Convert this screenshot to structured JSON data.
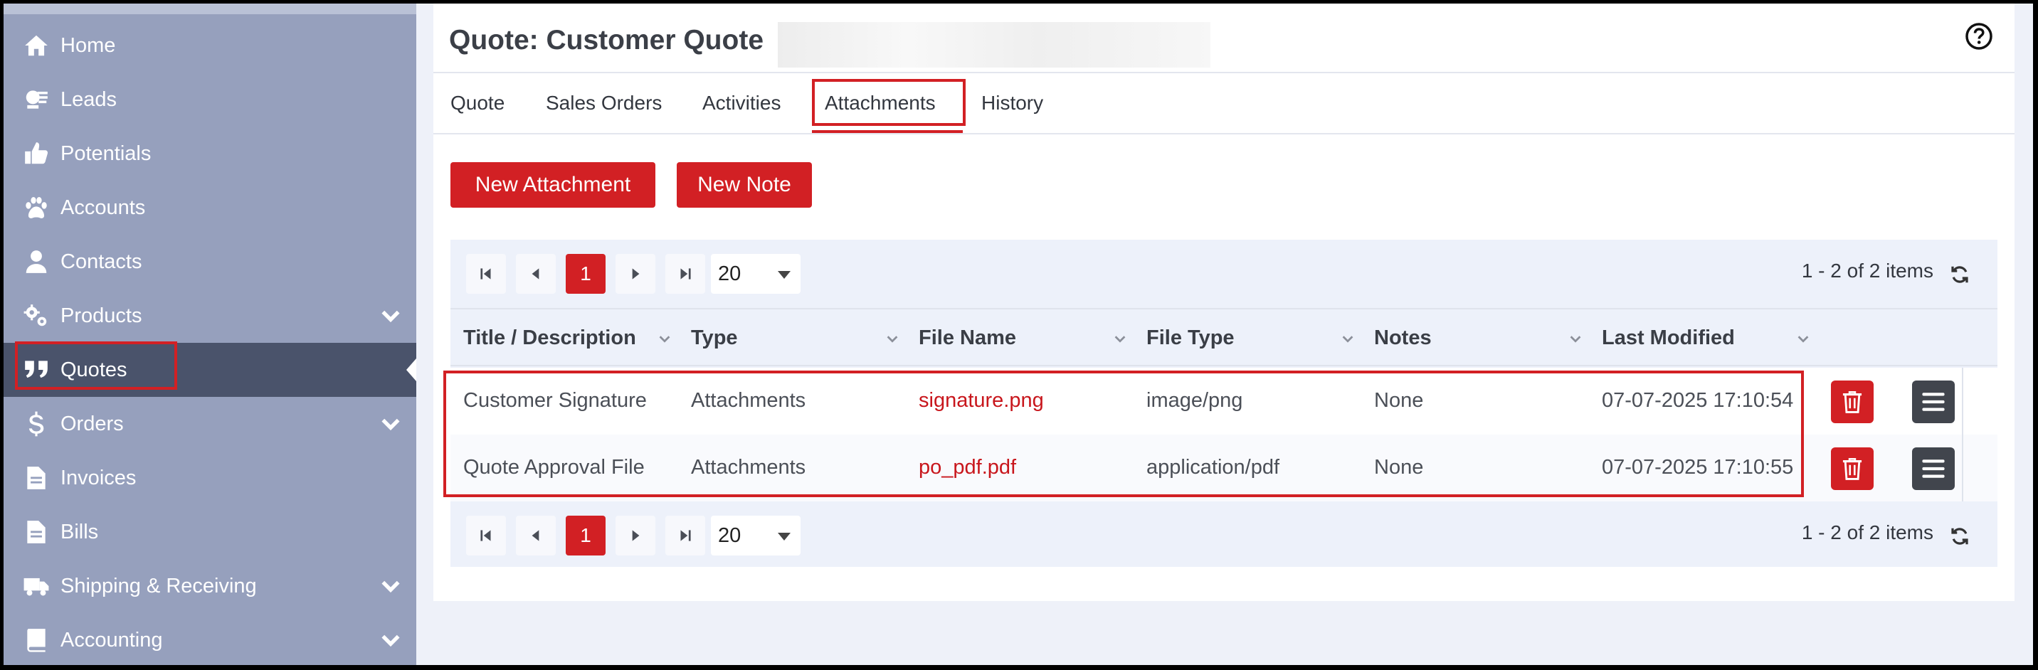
{
  "sidebar": {
    "items": [
      {
        "label": "Home",
        "icon": "home-icon"
      },
      {
        "label": "Leads",
        "icon": "leads-icon"
      },
      {
        "label": "Potentials",
        "icon": "thumbs-up-icon"
      },
      {
        "label": "Accounts",
        "icon": "paw-icon"
      },
      {
        "label": "Contacts",
        "icon": "user-icon"
      },
      {
        "label": "Products",
        "icon": "gears-icon",
        "expandable": true
      },
      {
        "label": "Quotes",
        "icon": "quote-icon",
        "active": true
      },
      {
        "label": "Orders",
        "icon": "dollar-icon",
        "expandable": true
      },
      {
        "label": "Invoices",
        "icon": "file-icon"
      },
      {
        "label": "Bills",
        "icon": "file-icon"
      },
      {
        "label": "Shipping & Receiving",
        "icon": "truck-icon",
        "expandable": true
      },
      {
        "label": "Accounting",
        "icon": "book-icon",
        "expandable": true
      }
    ]
  },
  "header": {
    "title": "Quote: Customer Quote",
    "help_icon": "question-circle-icon"
  },
  "tabs": [
    {
      "label": "Quote"
    },
    {
      "label": "Sales Orders"
    },
    {
      "label": "Activities"
    },
    {
      "label": "Attachments",
      "active": true
    },
    {
      "label": "History"
    }
  ],
  "toolbar": {
    "new_attachment_label": "New Attachment",
    "new_note_label": "New Note"
  },
  "pager": {
    "current_page": "1",
    "page_size": "20",
    "info": "1 - 2 of 2 items"
  },
  "table": {
    "columns": [
      "Title / Description",
      "Type",
      "File Name",
      "File Type",
      "Notes",
      "Last Modified"
    ],
    "rows": [
      {
        "title": "Customer Signature",
        "type": "Attachments",
        "file_name": "signature.png",
        "file_type": "image/png",
        "notes": "None",
        "last_modified": "07-07-2025 17:10:54"
      },
      {
        "title": "Quote Approval File",
        "type": "Attachments",
        "file_name": "po_pdf.pdf",
        "file_type": "application/pdf",
        "notes": "None",
        "last_modified": "07-07-2025 17:10:55"
      }
    ]
  },
  "colors": {
    "accent": "#d22024",
    "sidebar_bg": "#96a0bd",
    "sidebar_active": "#4a536b",
    "page_bg": "#eef1f9"
  }
}
